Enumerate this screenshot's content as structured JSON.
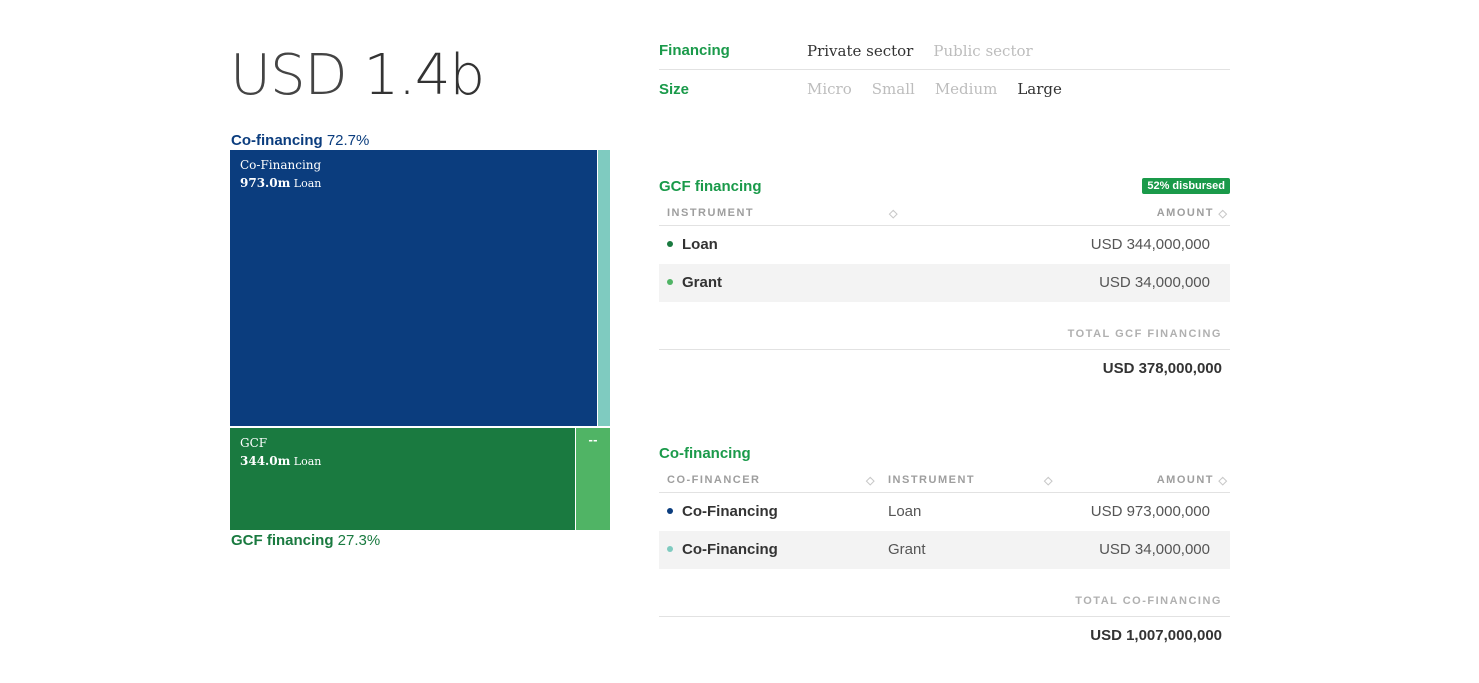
{
  "summary": {
    "currency": "USD",
    "value": "1.4b"
  },
  "treemap": {
    "top_label": {
      "name": "Co-financing",
      "pct": "72.7%"
    },
    "bottom_label": {
      "name": "GCF financing",
      "pct": "27.3%"
    },
    "cells": {
      "cofinancing_loan": {
        "name": "Co-Financing",
        "amount": "973.0m",
        "instrument": "Loan",
        "color": "#0b3d7e"
      },
      "cofinancing_grant": {
        "color": "#7fcbc0"
      },
      "gcf_loan": {
        "name": "GCF",
        "amount": "344.0m",
        "instrument": "Loan",
        "color": "#1a7a40"
      },
      "gcf_grant": {
        "dots": "--",
        "color": "#50b465"
      }
    }
  },
  "filters": {
    "financing": {
      "label": "Financing",
      "options": [
        "Private sector",
        "Public sector"
      ],
      "active": "Private sector"
    },
    "size": {
      "label": "Size",
      "options": [
        "Micro",
        "Small",
        "Medium",
        "Large"
      ],
      "active": "Large"
    }
  },
  "gcf_financing": {
    "title": "GCF financing",
    "badge": "52% disbursed",
    "headers": {
      "instrument": "INSTRUMENT",
      "amount": "AMOUNT"
    },
    "rows": [
      {
        "instrument": "Loan",
        "amount": "USD 344,000,000",
        "dot_color": "#1a7a40"
      },
      {
        "instrument": "Grant",
        "amount": "USD 34,000,000",
        "dot_color": "#50b465"
      }
    ],
    "total_label": "TOTAL GCF FINANCING",
    "total_value": "USD 378,000,000"
  },
  "co_financing": {
    "title": "Co-financing",
    "headers": {
      "cofinancer": "CO-FINANCER",
      "instrument": "INSTRUMENT",
      "amount": "AMOUNT"
    },
    "rows": [
      {
        "cofinancer": "Co-Financing",
        "instrument": "Loan",
        "amount": "USD 973,000,000",
        "dot_color": "#0b3d7e"
      },
      {
        "cofinancer": "Co-Financing",
        "instrument": "Grant",
        "amount": "USD 34,000,000",
        "dot_color": "#7fcbc0"
      }
    ],
    "total_label": "TOTAL CO-FINANCING",
    "total_value": "USD 1,007,000,000"
  }
}
